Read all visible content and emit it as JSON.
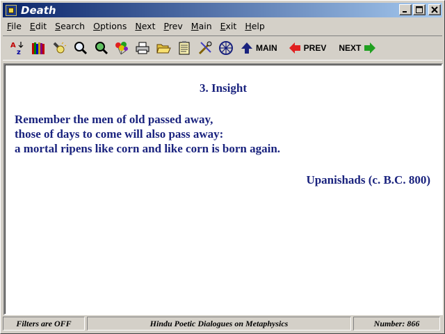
{
  "window": {
    "title": "Death",
    "minimize": "_",
    "maximize": "□",
    "close": "✕"
  },
  "menu": {
    "items": [
      {
        "label": "File",
        "key": "F",
        "rest": "ile"
      },
      {
        "label": "Edit",
        "key": "E",
        "rest": "dit"
      },
      {
        "label": "Search",
        "key": "S",
        "rest": "earch"
      },
      {
        "label": "Options",
        "key": "O",
        "rest": "ptions"
      },
      {
        "label": "Next",
        "key": "N",
        "rest": "ext"
      },
      {
        "label": "Prev",
        "key": "P",
        "rest": "rev"
      },
      {
        "label": "Main",
        "key": "M",
        "rest": "ain"
      },
      {
        "label": "Exit",
        "key": "E",
        "rest": "xit"
      },
      {
        "label": "Help",
        "key": "H",
        "rest": "elp"
      }
    ]
  },
  "toolbar": {
    "icons": [
      "sort-az-icon",
      "books-icon",
      "flashlight-icon",
      "magnifier-icon",
      "magnifier-green-icon",
      "balloons-icon",
      "printer-icon",
      "folder-open-icon",
      "notepad-icon",
      "tools-icon",
      "wheel-icon"
    ],
    "main_label": "MAIN",
    "prev_label": "PREV",
    "next_label": "NEXT"
  },
  "content": {
    "heading": "3. Insight",
    "lines": [
      "Remember the men of old passed away,",
      "those of days to come will also pass away:",
      "a mortal ripens like corn and like corn is born again."
    ],
    "attribution": "Upanishads (c. B.C. 800)"
  },
  "status": {
    "filters": "Filters are OFF",
    "collection": "Hindu Poetic Dialogues on Metaphysics",
    "number": "Number:  866"
  },
  "colors": {
    "text_accent": "#1a237e",
    "title_gradient_start": "#0a246a",
    "title_gradient_end": "#a6caf0"
  }
}
